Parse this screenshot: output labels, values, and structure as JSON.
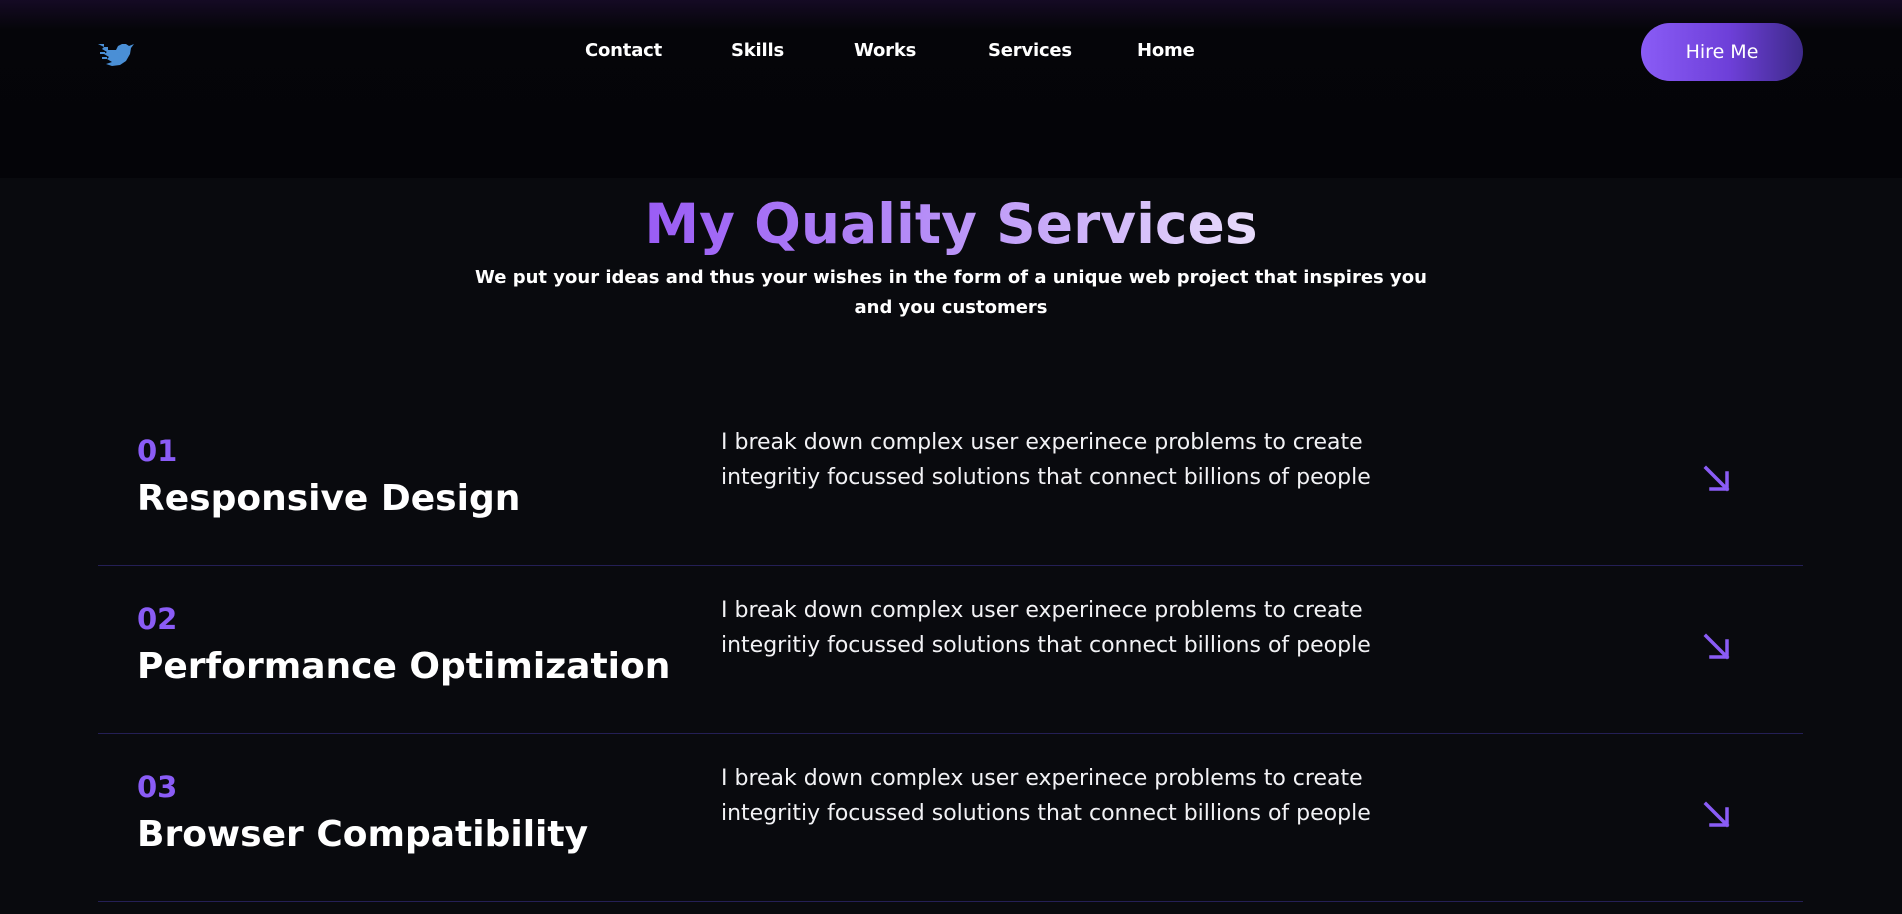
{
  "header": {
    "logo_icon": "bird-logo-icon",
    "nav": [
      "Contact",
      "Skills",
      "Works",
      "Services",
      "Home"
    ],
    "hire_label": "Hire Me"
  },
  "services": {
    "title": "My Quality Services",
    "subtitle": "We put your ideas and thus your wishes in the form of a unique web project that inspires you and you customers",
    "items": [
      {
        "num": "01",
        "title": "Responsive Design",
        "desc": "I break down complex user experinece problems to create integritiy focussed solutions that connect billions of people",
        "icon": "arrow-down-right-icon"
      },
      {
        "num": "02",
        "title": "Performance Optimization",
        "desc": "I break down complex user experinece problems to create integritiy focussed solutions that connect billions of people",
        "icon": "arrow-down-right-icon"
      },
      {
        "num": "03",
        "title": "Browser Compatibility",
        "desc": "I break down complex user experinece problems to create integritiy focussed solutions that connect billions of people",
        "icon": "arrow-down-right-icon"
      }
    ]
  },
  "colors": {
    "accent": "#8a5cf6",
    "background": "#090a0e",
    "divider": "#241f55",
    "logo": "#4a8fd6"
  }
}
